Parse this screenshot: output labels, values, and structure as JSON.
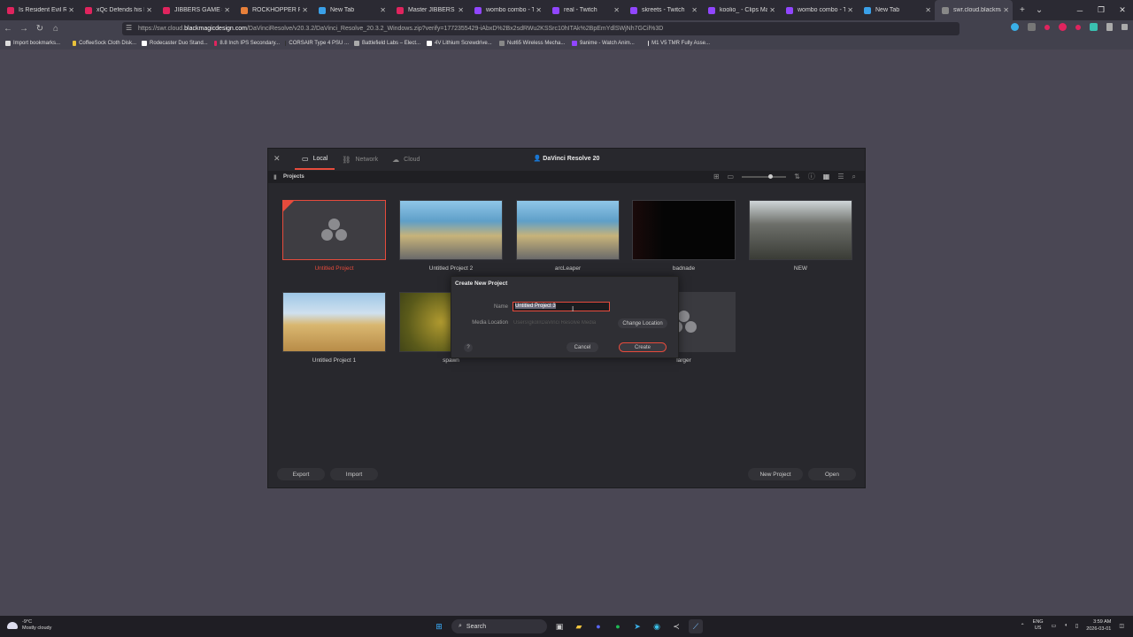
{
  "browser": {
    "tabs": [
      {
        "title": "Is Resident Evil Requi",
        "color": "#e0245e"
      },
      {
        "title": "xQc Defends his Bask",
        "color": "#e0245e"
      },
      {
        "title": "JIBBERS GAME #skiing",
        "color": "#e0245e"
      },
      {
        "title": "ROCKHOPPER PENGU",
        "color": "#e8803a"
      },
      {
        "title": "New Tab",
        "color": "#3aa0e8"
      },
      {
        "title": "Master JIBBERS Fast",
        "color": "#e0245e"
      },
      {
        "title": "wombo combo - Twitc",
        "color": "#9146ff"
      },
      {
        "title": "real - Twitch",
        "color": "#9146ff"
      },
      {
        "title": "skreets - Twitch",
        "color": "#9146ff"
      },
      {
        "title": "koolio_ - Clips Manag",
        "color": "#9146ff"
      },
      {
        "title": "wombo combo - Twit",
        "color": "#9146ff"
      },
      {
        "title": "New Tab",
        "color": "#3aa0e8"
      },
      {
        "title": "swr.cloud.blackmagicdesi",
        "color": "#888888"
      }
    ],
    "url_prefix": "https://swr.cloud.",
    "url_host": "blackmagicdesign.com",
    "url_path": "/DaVinciResolve/v20.3.2/DaVinci_Resolve_20.3.2_Windows.zip?verify=1772355429-iAbxD%2Bx2sdRWu2KSSrc10hITAk%2BpEmYdlSWjNh7GCil%3D",
    "bookmarks": [
      {
        "label": "Import bookmarks...",
        "color": "#dddddd"
      },
      {
        "label": "CoffeeSock Cloth Disk...",
        "color": "#e8c13a"
      },
      {
        "label": "Rodecaster Duo Stand...",
        "color": "#ffffff"
      },
      {
        "label": "8.8 Inch IPS Secondary...",
        "color": "#e0245e"
      },
      {
        "label": "CORSAIR Type 4 PSU ...",
        "color": "#333333"
      },
      {
        "label": "Battlefield Labs – Elect...",
        "color": "#aaaaaa"
      },
      {
        "label": "4V Lithium Screwdrive...",
        "color": "#ffffff"
      },
      {
        "label": "Nut65 Wireless Mecha...",
        "color": "#888888"
      },
      {
        "label": "9anime - Watch Anim...",
        "color": "#9146ff"
      },
      {
        "label": "M1 V5 TMR Fully Asse...",
        "color": "#dddddd"
      }
    ]
  },
  "resolve": {
    "title": "DaVinci Resolve 20",
    "tabs": [
      "Local",
      "Network",
      "Cloud"
    ],
    "section_label": "Projects",
    "projects": [
      {
        "name": "Untitled Project",
        "selected": true,
        "kind": "logo"
      },
      {
        "name": "Untitled Project 2",
        "selected": false,
        "kind": "game1"
      },
      {
        "name": "arcLeaper",
        "selected": false,
        "kind": "game1"
      },
      {
        "name": "badnade",
        "selected": false,
        "kind": "dark"
      },
      {
        "name": "NEW",
        "selected": false,
        "kind": "room"
      },
      {
        "name": "Untitled Project 1",
        "selected": false,
        "kind": "desert"
      },
      {
        "name": "spawn",
        "selected": false,
        "kind": "green"
      },
      {
        "name": "larger",
        "selected": false,
        "kind": "logo"
      }
    ],
    "buttons": {
      "export": "Export",
      "import": "Import",
      "new_project": "New Project",
      "open": "Open"
    }
  },
  "dialog": {
    "title": "Create New Project",
    "name_label": "Name",
    "name_value": "Untitled Project 3",
    "media_label": "Media Location",
    "media_path": "Users\\gkoli\\DaVinci Resolve Media",
    "change_location": "Change Location",
    "cancel": "Cancel",
    "create": "Create",
    "help": "?"
  },
  "taskbar": {
    "temp": "-9°C",
    "weather": "Mostly cloudy",
    "search": "Search",
    "lang1": "ENG",
    "lang2": "US",
    "time": "3:59 AM",
    "date": "2026-03-01"
  }
}
